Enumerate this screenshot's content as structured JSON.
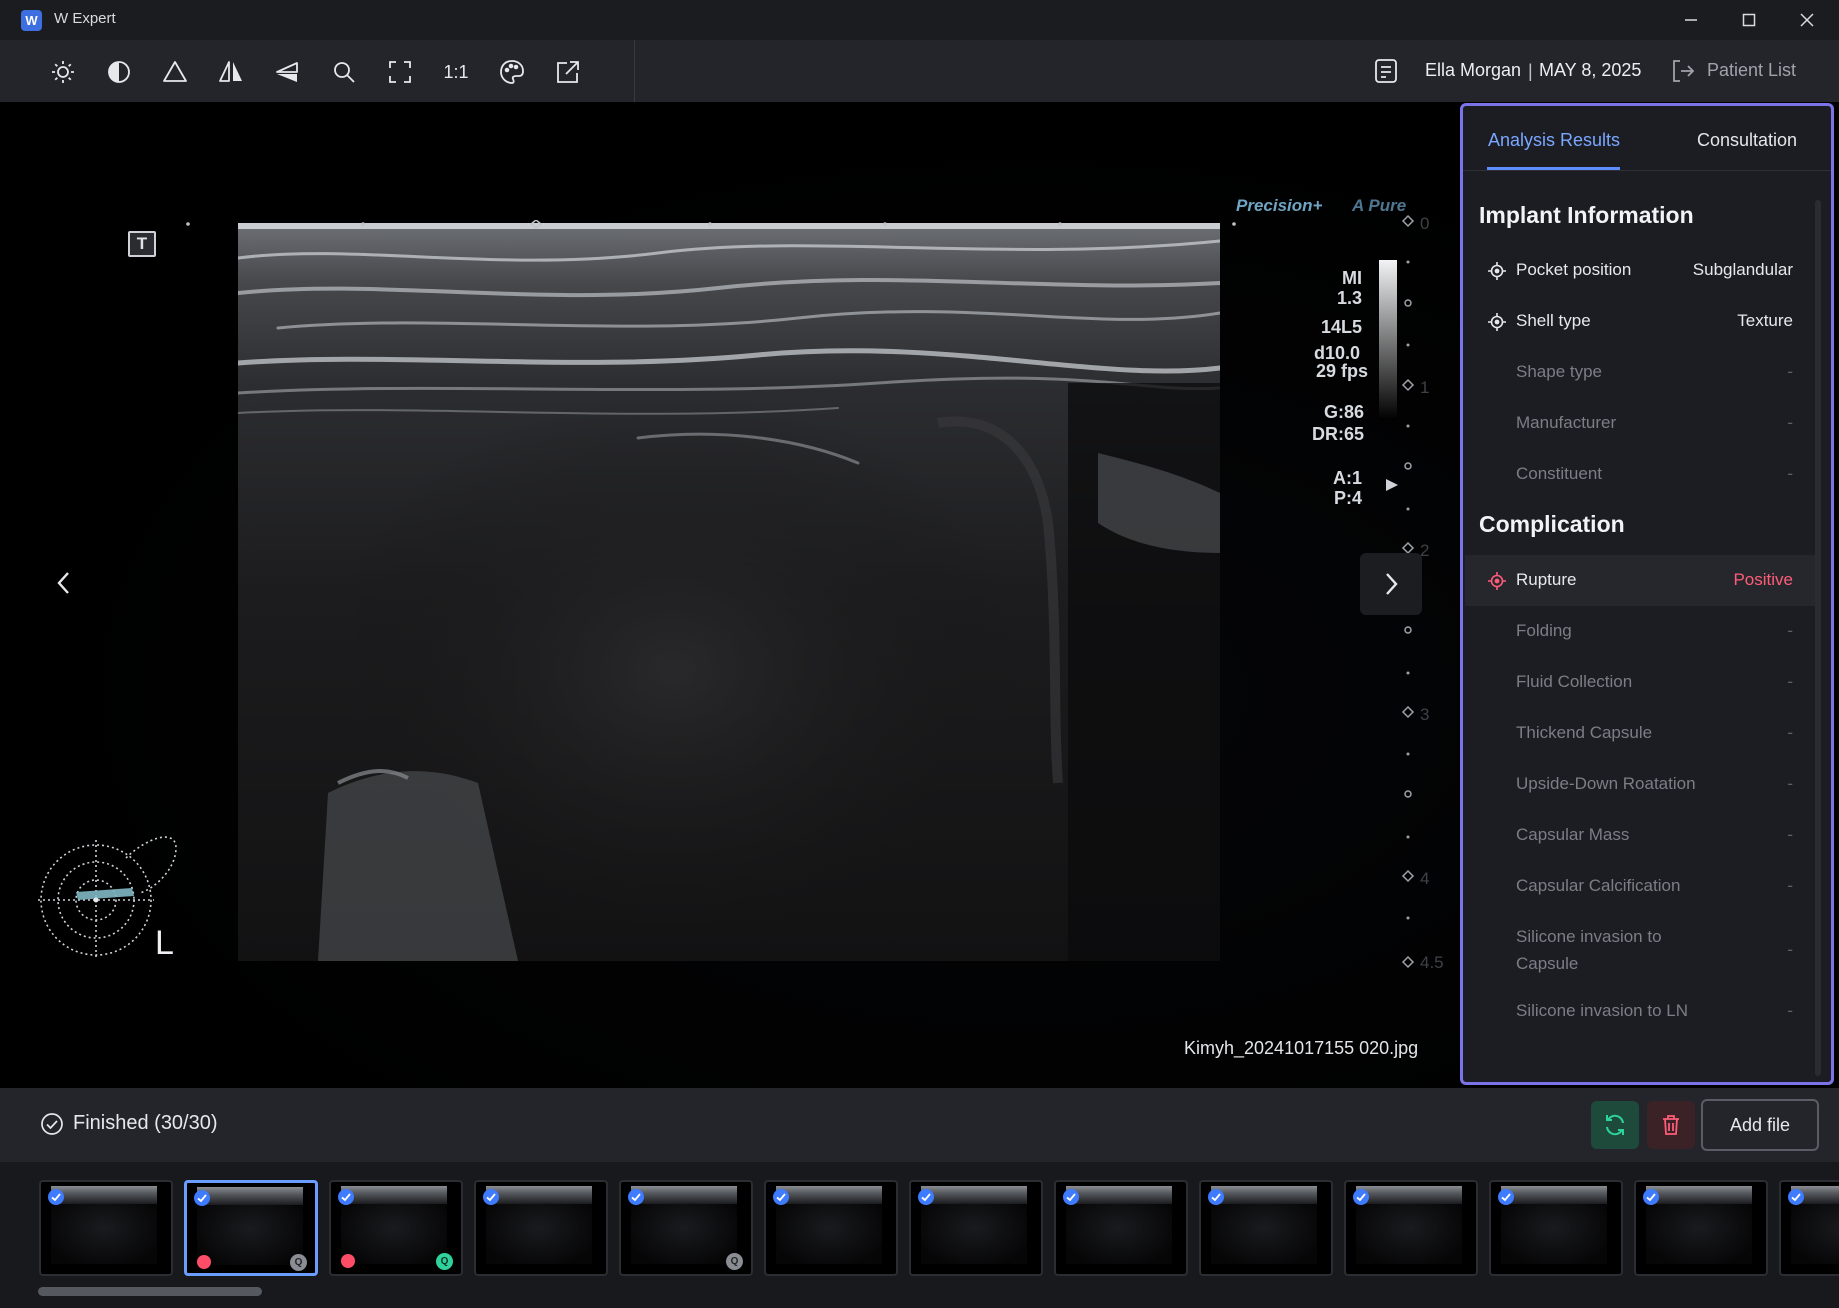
{
  "app": {
    "title": "W Expert",
    "logo_letter": "W"
  },
  "toolbar": {
    "tools": [
      "brightness-icon",
      "contrast-icon",
      "sharpen-icon",
      "flip-horizontal-icon",
      "flip-vertical-icon",
      "zoom-icon",
      "fit-screen-icon",
      "actual-size",
      "palette-icon",
      "export-icon"
    ],
    "actual_size_label": "1:1",
    "patient_name": "Ella Morgan",
    "separator": "|",
    "exam_date": "MAY 8, 2025",
    "patient_list_label": "Patient List"
  },
  "viewer": {
    "brand_primary": "Precision+",
    "brand_secondary": "A Pure",
    "badge": "T",
    "mi_label": "MI",
    "mi_value": "1.3",
    "probe": "14L5",
    "depth": "d10.0",
    "fps": "29 fps",
    "gain": "G:86",
    "dynamic_range": "DR:65",
    "a_value": "A:1",
    "p_value": "P:4",
    "depth_scale": [
      "0",
      "1",
      "2",
      "3",
      "4",
      "4.5"
    ],
    "side_label": "L",
    "filename": "Kimyh_20241017155 020.jpg"
  },
  "panel": {
    "tabs": [
      {
        "label": "Analysis Results",
        "active": true
      },
      {
        "label": "Consultation",
        "active": false
      }
    ],
    "implant_title": "Implant Information",
    "implant_rows": [
      {
        "label": "Pocket position",
        "value": "Subglandular",
        "icon": "target-icon"
      },
      {
        "label": "Shell type",
        "value": "Texture",
        "icon": "target-icon"
      },
      {
        "label": "Shape type",
        "value": "-"
      },
      {
        "label": "Manufacturer",
        "value": "-"
      },
      {
        "label": "Constituent",
        "value": "-"
      }
    ],
    "complication_title": "Complication",
    "complication_rows": [
      {
        "label": "Rupture",
        "value": "Positive",
        "icon": "target-icon"
      },
      {
        "label": "Folding",
        "value": "-"
      },
      {
        "label": "Fluid Collection",
        "value": "-"
      },
      {
        "label": "Thickend Capsule",
        "value": "-"
      },
      {
        "label": "Upside-Down Roatation",
        "value": "-"
      },
      {
        "label": "Capsular Mass",
        "value": "-"
      },
      {
        "label": "Capsular Calcification",
        "value": "-"
      },
      {
        "label": "Silicone invasion to",
        "label2": "Capsule",
        "value": "-"
      },
      {
        "label": "Silicone invasion to LN",
        "value": "-"
      }
    ]
  },
  "status": {
    "text": "Finished (30/30)",
    "add_file_label": "Add file"
  },
  "thumbnails": [
    {
      "checked": true,
      "selected": false,
      "red_dot": false,
      "q": ""
    },
    {
      "checked": true,
      "selected": true,
      "red_dot": true,
      "q": "gray"
    },
    {
      "checked": true,
      "selected": false,
      "red_dot": true,
      "q": "green"
    },
    {
      "checked": true,
      "selected": false,
      "red_dot": false,
      "q": ""
    },
    {
      "checked": true,
      "selected": false,
      "red_dot": false,
      "q": "gray"
    },
    {
      "checked": true,
      "selected": false,
      "red_dot": false,
      "q": ""
    },
    {
      "checked": true,
      "selected": false,
      "red_dot": false,
      "q": ""
    },
    {
      "checked": true,
      "selected": false,
      "red_dot": false,
      "q": ""
    },
    {
      "checked": true,
      "selected": false,
      "red_dot": false,
      "q": ""
    },
    {
      "checked": true,
      "selected": false,
      "red_dot": false,
      "q": ""
    },
    {
      "checked": true,
      "selected": false,
      "red_dot": false,
      "q": ""
    },
    {
      "checked": true,
      "selected": false,
      "red_dot": false,
      "q": ""
    },
    {
      "checked": true,
      "selected": false,
      "red_dot": false,
      "q": ""
    }
  ],
  "colors": {
    "accent": "#5d8dff",
    "panel_border": "#7b73e8",
    "positive": "#ff5c78",
    "refresh": "#2fd29a",
    "delete": "#ff5c78"
  }
}
